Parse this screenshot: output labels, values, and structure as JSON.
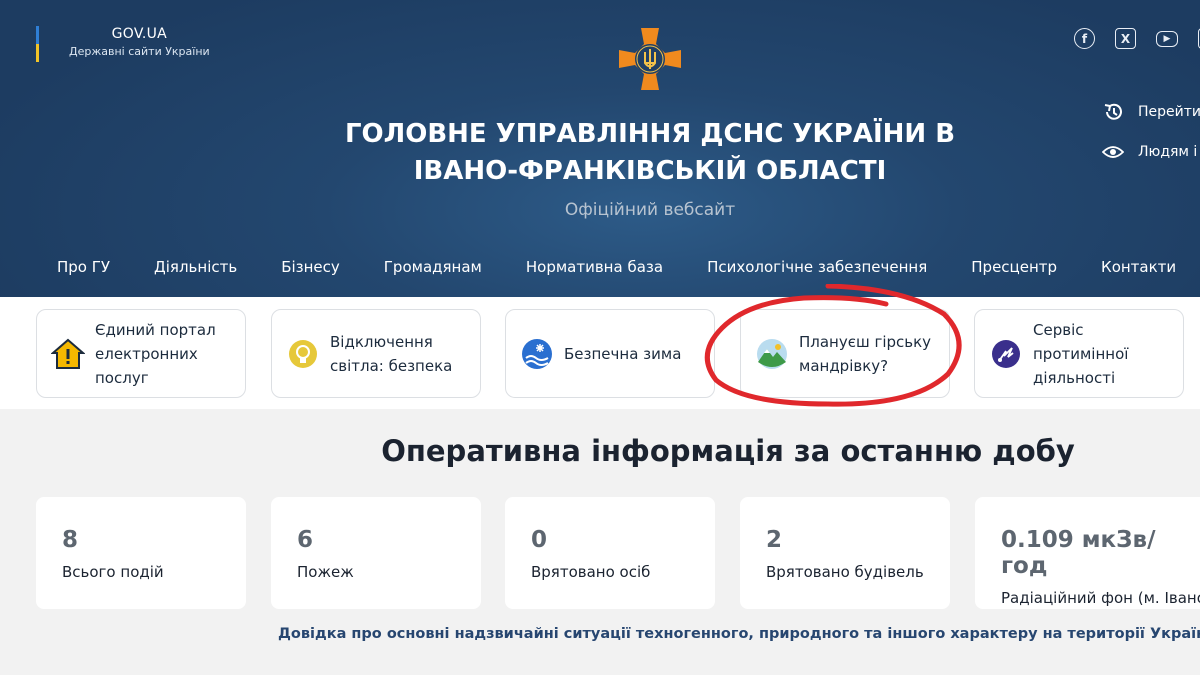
{
  "gov": {
    "name": "GOV.UA",
    "subtitle": "Державні сайти України"
  },
  "header": {
    "title_line1": "ГОЛОВНЕ УПРАВЛІННЯ ДСНС УКРАЇНИ В",
    "title_line2": "ІВАНО-ФРАНКІВСЬКІЙ ОБЛАСТІ",
    "subtitle": "Офіційний вебсайт"
  },
  "socials": [
    {
      "icon": "facebook-icon",
      "glyph": "f"
    },
    {
      "icon": "x-icon",
      "glyph": "X"
    },
    {
      "icon": "youtube-icon",
      "glyph": "▶"
    },
    {
      "icon": "instagram-icon",
      "glyph": ""
    }
  ],
  "side_links": [
    {
      "icon": "history-icon",
      "label": "Перейти"
    },
    {
      "icon": "eye-icon",
      "label": "Людям і"
    }
  ],
  "nav": [
    "Про ГУ",
    "Діяльність",
    "Бізнесу",
    "Громадянам",
    "Нормативна база",
    "Психологічне забезпечення",
    "Пресцентр",
    "Контакти"
  ],
  "quick_cards": [
    {
      "icon": "warning-house-icon",
      "lines": [
        "Єдиний портал",
        "електронних",
        "послуг"
      ]
    },
    {
      "icon": "lightbulb-icon",
      "lines": [
        "Відключення",
        "світла: безпека"
      ]
    },
    {
      "icon": "winter-icon",
      "lines": [
        "Безпечна зима"
      ]
    },
    {
      "icon": "mountain-icon",
      "lines": [
        "Плануєш гірську",
        "мандрівку?"
      ]
    },
    {
      "icon": "demining-icon",
      "lines": [
        "Сервіс протимінної",
        "діяльності"
      ]
    }
  ],
  "operative": {
    "title": "Оперативна інформація за останню добу",
    "stats": [
      {
        "value": "8",
        "label": "Всього подій"
      },
      {
        "value": "6",
        "label": "Пожеж"
      },
      {
        "value": "0",
        "label": "Врятовано осіб"
      },
      {
        "value": "2",
        "label": "Врятовано будівель"
      },
      {
        "value": "0.109 мкЗв/год",
        "label": "Радіаційний фон (м. Івано"
      }
    ]
  },
  "reference": {
    "text": "Довідка про основні надзвичайні ситуації техногенного, природного та іншого характеру на території України",
    "button": "›"
  },
  "colors": {
    "header_bg": "#23476f",
    "accent_orange": "#f08a1e",
    "annotation_red": "#e0282c",
    "link_blue": "#274670"
  }
}
